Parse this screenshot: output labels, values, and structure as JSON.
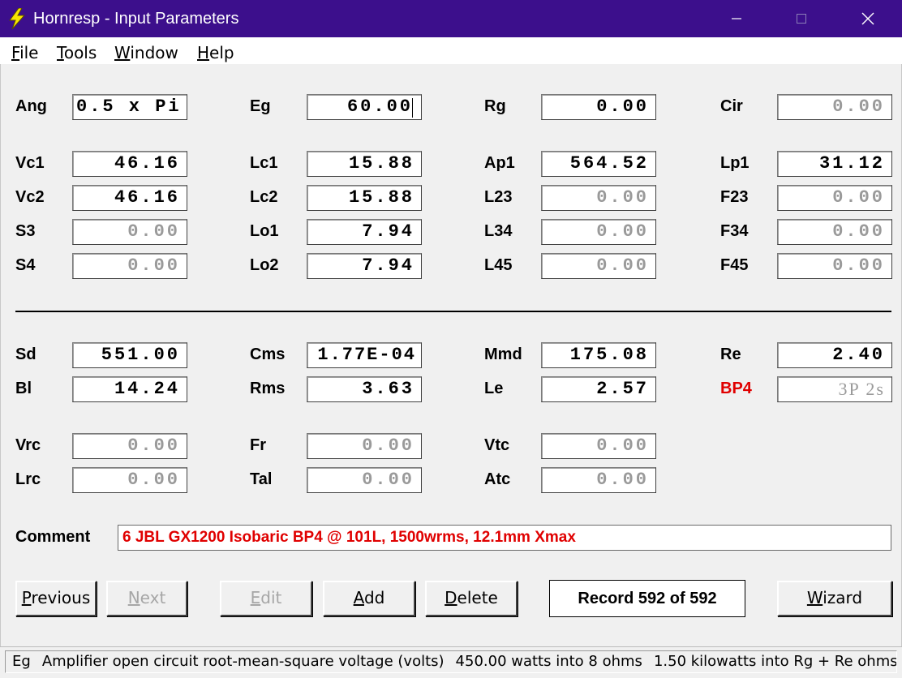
{
  "window": {
    "title": "Hornresp - Input Parameters",
    "title_bar_color": "#3c0f8c"
  },
  "icons": {
    "app": "lightning-bolt-icon",
    "minimize": "minimize-icon",
    "maximize": "maximize-icon",
    "close": "close-icon"
  },
  "menu": [
    {
      "accel": "F",
      "rest": "ile"
    },
    {
      "accel": "T",
      "rest": "ools"
    },
    {
      "accel": "W",
      "rest": "indow"
    },
    {
      "accel": "H",
      "rest": "elp"
    }
  ],
  "params": {
    "ang": {
      "label": "Ang",
      "value": "0.5 x Pi"
    },
    "eg": {
      "label": "Eg",
      "value": "60.00"
    },
    "rg": {
      "label": "Rg",
      "value": "0.00"
    },
    "cir": {
      "label": "Cir",
      "value": "0.00"
    },
    "vc1": {
      "label": "Vc1",
      "value": "46.16"
    },
    "lc1": {
      "label": "Lc1",
      "value": "15.88"
    },
    "ap1": {
      "label": "Ap1",
      "value": "564.52"
    },
    "lp1": {
      "label": "Lp1",
      "value": "31.12"
    },
    "vc2": {
      "label": "Vc2",
      "value": "46.16"
    },
    "lc2": {
      "label": "Lc2",
      "value": "15.88"
    },
    "l23": {
      "label": "L23",
      "value": "0.00"
    },
    "f23": {
      "label": "F23",
      "value": "0.00"
    },
    "s3": {
      "label": "S3",
      "value": "0.00"
    },
    "lo1": {
      "label": "Lo1",
      "value": "7.94"
    },
    "l34": {
      "label": "L34",
      "value": "0.00"
    },
    "f34": {
      "label": "F34",
      "value": "0.00"
    },
    "s4": {
      "label": "S4",
      "value": "0.00"
    },
    "lo2": {
      "label": "Lo2",
      "value": "7.94"
    },
    "l45": {
      "label": "L45",
      "value": "0.00"
    },
    "f45": {
      "label": "F45",
      "value": "0.00"
    },
    "sd": {
      "label": "Sd",
      "value": "551.00"
    },
    "cms": {
      "label": "Cms",
      "value": "1.77E-04"
    },
    "mmd": {
      "label": "Mmd",
      "value": "175.08"
    },
    "re": {
      "label": "Re",
      "value": "2.40"
    },
    "bl": {
      "label": "Bl",
      "value": "14.24"
    },
    "rms": {
      "label": "Rms",
      "value": "3.63"
    },
    "le": {
      "label": "Le",
      "value": "2.57"
    },
    "bp4": {
      "label": "BP4",
      "value": "3P 2s",
      "label_color": "#e00000"
    },
    "vrc": {
      "label": "Vrc",
      "value": "0.00"
    },
    "fr": {
      "label": "Fr",
      "value": "0.00"
    },
    "vtc": {
      "label": "Vtc",
      "value": "0.00"
    },
    "lrc": {
      "label": "Lrc",
      "value": "0.00"
    },
    "tal": {
      "label": "Tal",
      "value": "0.00"
    },
    "atc": {
      "label": "Atc",
      "value": "0.00"
    }
  },
  "comment": {
    "label": "Comment",
    "value": "6 JBL GX1200 Isobaric BP4 @ 101L, 1500wrms, 12.1mm Xmax",
    "text_color": "#e00000"
  },
  "buttons": {
    "previous": {
      "accel": "P",
      "rest": "revious"
    },
    "next": {
      "accel": "N",
      "rest": "ext"
    },
    "edit": {
      "accel": "E",
      "rest": "dit"
    },
    "add": {
      "accel": "A",
      "rest": "dd"
    },
    "delete": {
      "accel": "D",
      "rest": "elete"
    },
    "wizard": {
      "accel": "W",
      "rest": "izard"
    }
  },
  "record": "Record 592 of 592",
  "status": {
    "param": "Eg",
    "description": "Amplifier open circuit root-mean-square voltage  (volts)",
    "power_8ohm": "450.00 watts into 8 ohms",
    "power_rg_re": "1.50 kilowatts into Rg + Re ohms"
  }
}
